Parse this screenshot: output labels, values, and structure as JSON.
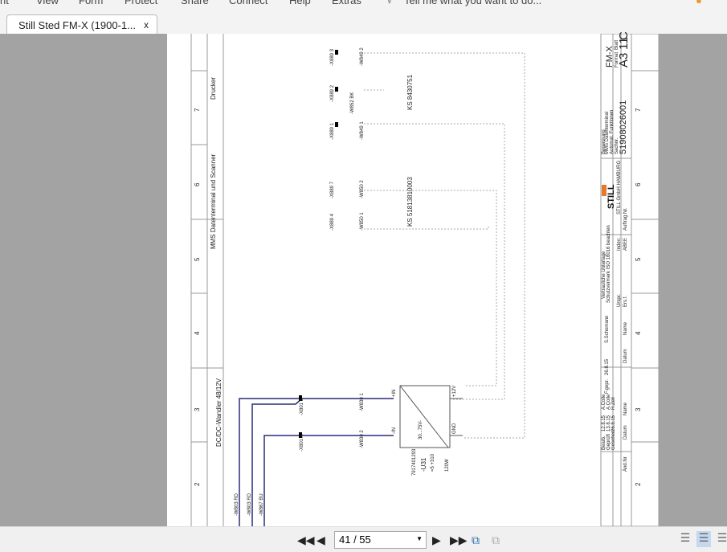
{
  "menu": [
    "nt",
    "View",
    "Form",
    "Protect",
    "Share",
    "Connect",
    "Help",
    "Extras"
  ],
  "tell_me": "Tell me what you want to do...",
  "tab": {
    "title": "Still Sted FM-X (1900-1...",
    "close": "x"
  },
  "toolbar": {
    "page": "41 / 55"
  },
  "drawing": {
    "columns": [
      "7",
      "6",
      "5",
      "4",
      "3",
      "2"
    ],
    "section_drucker": "Drucker",
    "section_mms": "MMS Datenterminal und Scanner",
    "section_dcdc": "DC/DC-Wandler 48/12V",
    "ks1": "KS 8430751",
    "ks2": "KS 51813810003",
    "conn": [
      "-X889 3",
      "-X889 2",
      "-X889 1",
      "-X889 7",
      "-X889 4"
    ],
    "wires_top": [
      "-W849 2",
      "-W852 BK",
      "-W849 1",
      "-W850 2",
      "-W850 1"
    ],
    "xb1": "-X801 B",
    "xa1": "-X801 A",
    "w830_1": "-W830 1",
    "w830_2": "-W830 2",
    "pin_in_p": "+IN",
    "pin_in_n": "-IN",
    "pin_12v": "+12V",
    "pin_gnd": "GND",
    "conv_range": "30...75V-",
    "conv_part": "7917401293",
    "conv_id": "-U31",
    "conv_loc": "=5 +310",
    "conv_pow": "120W",
    "bottom_wires": [
      "-W803 RD",
      "-W803 RD",
      "-W867 BU"
    ],
    "title_block": {
      "fm": "FM-X",
      "format_label": "Format",
      "format": "A3",
      "sheet_label": "Blatt",
      "sheet": "11",
      "c": "C",
      "desc1": "Benennung",
      "desc2": "MMS Datenterminal",
      "desc3": "Automat. Funktionen",
      "desc4": "Sachnr.",
      "docno": "51908026001",
      "brand": "STILL",
      "brand_sub": "STILL GmbH HAMBURG",
      "auftrag": "Auftrag Nr.",
      "index_label": "Index:",
      "index": "ABEE",
      "urspr": "Urspr.",
      "ersf": "Ers.f.",
      "note1": "Vertrauliche Unterlage",
      "note2": "Schutzvermerk ISO 16016 beachten",
      "name_label": "Name",
      "datum_label": "Datum",
      "schoenen": "S.Schomann",
      "gepr": "F.gepr.",
      "gepr_date": "26.8.15",
      "bearb": "Bearb.",
      "bearb_date": "12.8.15",
      "bearb_name": "A.Colle",
      "geprueft": "Geprüft",
      "geprueft_date": "13.8.15",
      "geprueft_name": "A.Colle",
      "gesehen": "Gesehen",
      "gesehen_date": "26.8.15",
      "gesehen_name": "R.Zell",
      "aend": "Änd.Nr"
    }
  },
  "colors": {
    "wire": "#2a2a7a",
    "accent": "#e8782a"
  }
}
